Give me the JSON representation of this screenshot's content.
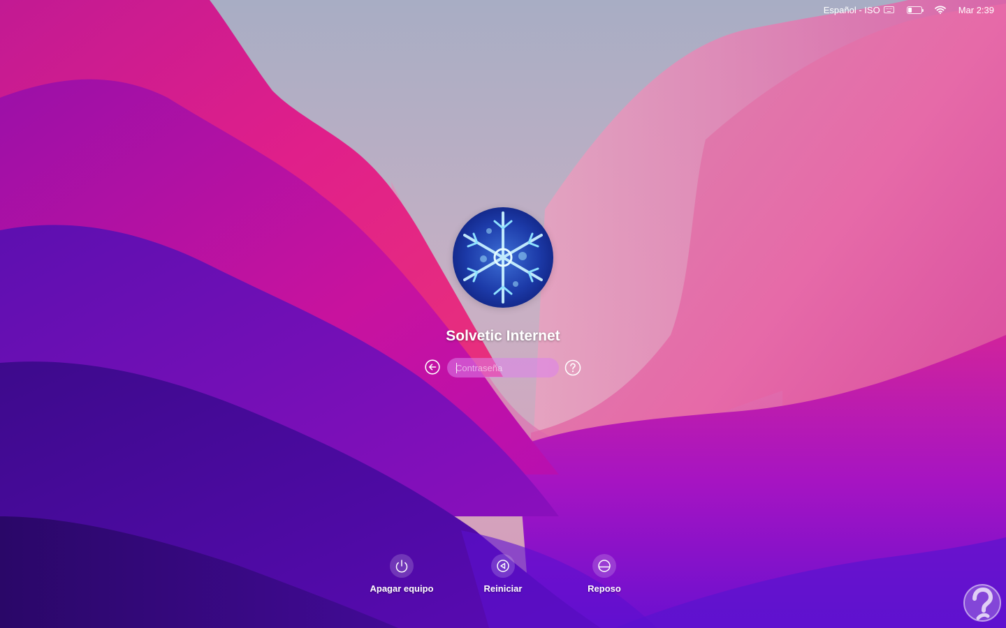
{
  "menubar": {
    "keyboard_layout": "Español - ISO",
    "clock": "Mar 2:39",
    "icons": [
      "keyboard-icon",
      "battery-icon",
      "wifi-icon"
    ]
  },
  "login": {
    "avatar": "snowflake-avatar",
    "username": "Solvetic Internet",
    "password_placeholder": "Contraseña",
    "back_icon": "arrow-left-circle-icon",
    "help_icon": "question-circle-icon"
  },
  "actions": [
    {
      "label": "Apagar equipo",
      "icon": "power-icon"
    },
    {
      "label": "Reiniciar",
      "icon": "restart-icon"
    },
    {
      "label": "Reposo",
      "icon": "sleep-icon"
    }
  ],
  "colors": {
    "accent_pink": "#e0229a",
    "deep_purple": "#3a0a8a",
    "magenta": "#c10fb4",
    "sky": "#b7b2c0"
  }
}
